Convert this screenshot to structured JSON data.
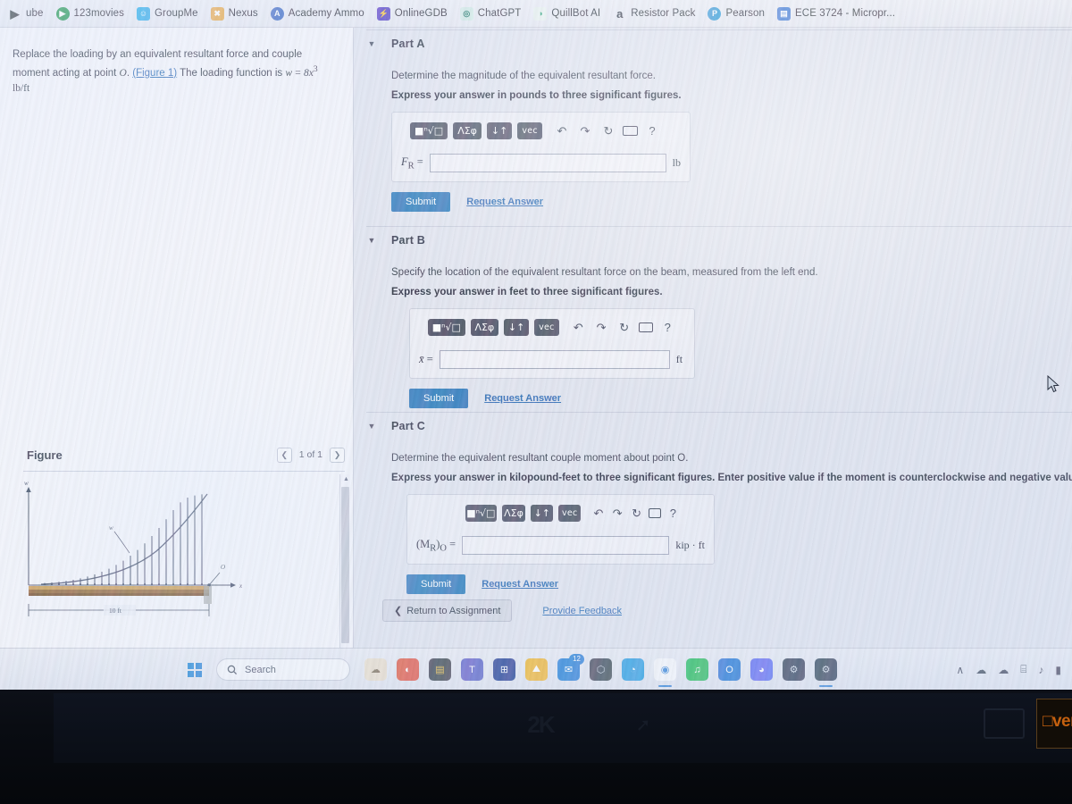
{
  "browser": {
    "bookmarks": [
      {
        "label": "ube",
        "icon": "youtube-icon",
        "icon_class": "ico-youtube",
        "glyph": "▶"
      },
      {
        "label": "123movies",
        "icon": "play-circle-icon",
        "icon_class": "ico-123movies",
        "glyph": "▶"
      },
      {
        "label": "GroupMe",
        "icon": "groupme-icon",
        "icon_class": "ico-groupme",
        "glyph": "☺"
      },
      {
        "label": "Nexus",
        "icon": "nexus-icon",
        "icon_class": "ico-nexus",
        "glyph": "✖"
      },
      {
        "label": "Academy Ammo",
        "icon": "academy-ammo-icon",
        "icon_class": "ico-academy",
        "glyph": "A"
      },
      {
        "label": "OnlineGDB",
        "icon": "onlinegdb-icon",
        "icon_class": "ico-onlinegdb",
        "glyph": "⚡"
      },
      {
        "label": "ChatGPT",
        "icon": "chatgpt-icon",
        "icon_class": "ico-chatgpt",
        "glyph": "◎"
      },
      {
        "label": "QuillBot AI",
        "icon": "quillbot-icon",
        "icon_class": "ico-quillbot",
        "glyph": "◑"
      },
      {
        "label": "Resistor Pack",
        "icon": "amazon-icon",
        "icon_class": "ico-amazon",
        "glyph": "a"
      },
      {
        "label": "Pearson",
        "icon": "pearson-icon",
        "icon_class": "ico-pearson",
        "glyph": "P"
      },
      {
        "label": "ECE 3724 - Micropr...",
        "icon": "canvas-icon",
        "icon_class": "ico-ece",
        "glyph": "▤"
      }
    ]
  },
  "problem": {
    "statement_part1": "Replace the loading by an equivalent resultant force and couple moment acting at point ",
    "point_label": "O",
    "statement_link": "(Figure 1)",
    "statement_part2": " The loading function is ",
    "loading_function": "w = 8x³ lb/ft",
    "loading_w": "w",
    "loading_eq": "=",
    "loading_rhs": "8x",
    "loading_exp": "3",
    "loading_units": "lb/ft"
  },
  "figure": {
    "title": "Figure",
    "pager": "1 of 1",
    "prev_icon": "chevron-left-icon",
    "next_icon": "chevron-right-icon",
    "dimension_label": "10 ft",
    "axis_w_label": "w",
    "axis_x_label": "x",
    "curve_label": "w",
    "point_label": "O"
  },
  "parts": [
    {
      "id": "part-a",
      "title": "Part A",
      "prompt": "Determine the magnitude of the equivalent resultant force.",
      "sub": "Express your answer in pounds to three significant figures.",
      "field_label": "F",
      "field_sub": "R",
      "field_eq": "=",
      "field_value": "",
      "unit": "lb",
      "submit_label": "Submit",
      "request_label": "Request Answer"
    },
    {
      "id": "part-b",
      "title": "Part B",
      "prompt": "Specify the location of the equivalent resultant force on the beam, measured from the left end.",
      "sub": "Express your answer in feet to three significant figures.",
      "field_label": "x̄",
      "field_sub": "",
      "field_eq": "=",
      "field_value": "",
      "unit": "ft",
      "submit_label": "Submit",
      "request_label": "Request Answer"
    },
    {
      "id": "part-c",
      "title": "Part C",
      "prompt": "Determine the equivalent resultant couple moment about point O.",
      "sub": "Express your answer in kilopound-feet to three significant figures. Enter positive value if the moment is counterclockwise and negative value if the moment is clockwise.",
      "field_label": "(M",
      "field_sub": "R",
      "field_close": ")",
      "field_sub2": "O",
      "field_eq": "=",
      "field_value": "",
      "unit": "kip · ft",
      "submit_label": "Submit",
      "request_label": "Request Answer"
    }
  ],
  "mathbar": {
    "buttons": [
      {
        "name": "template-root-button",
        "label": "■ⁿ√□"
      },
      {
        "name": "greek-symbols-button",
        "label": "ΛΣφ"
      },
      {
        "name": "more-templates-button",
        "label": "↓↑"
      },
      {
        "name": "vector-button",
        "label": "vec"
      }
    ],
    "tools": [
      {
        "name": "undo-icon",
        "label": "↶"
      },
      {
        "name": "redo-icon",
        "label": "↷"
      },
      {
        "name": "reset-icon",
        "label": "↻"
      },
      {
        "name": "keyboard-icon",
        "label": "⌨"
      },
      {
        "name": "help-icon",
        "label": "?"
      }
    ]
  },
  "footer": {
    "return_label": "Return to Assignment",
    "return_icon": "chevron-left-icon",
    "feedback_label": "Provide Feedback"
  },
  "taskbar": {
    "search_placeholder": "Search",
    "search_icon": "search-icon",
    "start_icon": "windows-start-icon",
    "apps": [
      {
        "name": "taskbar-icon-widgets",
        "glyph": "☁",
        "color": "#e8ddc9",
        "text": "#7a6a4f",
        "badge": "",
        "active": false
      },
      {
        "name": "taskbar-icon-paint",
        "glyph": "◐",
        "color": "#e0533f",
        "text": "#ffffff",
        "badge": "",
        "active": false
      },
      {
        "name": "taskbar-icon-file-explorer",
        "glyph": "▤",
        "color": "#3a3f4b",
        "text": "#f2c24a",
        "badge": "",
        "active": false
      },
      {
        "name": "taskbar-icon-teams",
        "glyph": "T",
        "color": "#5b5fc7",
        "text": "#ffffff",
        "badge": "",
        "active": false
      },
      {
        "name": "taskbar-icon-store",
        "glyph": "⊞",
        "color": "#1a3a8f",
        "text": "#ffffff",
        "badge": "",
        "active": false
      },
      {
        "name": "taskbar-icon-photos",
        "glyph": "⛰",
        "color": "#f0b429",
        "text": "#ffffff",
        "badge": "",
        "active": false
      },
      {
        "name": "taskbar-icon-mail",
        "glyph": "✉",
        "color": "#1f7ad6",
        "text": "#ffffff",
        "badge": "12",
        "active": false
      },
      {
        "name": "taskbar-icon-copilot",
        "glyph": "⬡",
        "color": "#39424f",
        "text": "#c7d0dd",
        "badge": "",
        "active": false
      },
      {
        "name": "taskbar-icon-edge",
        "glyph": "◔",
        "color": "#1f9ae0",
        "text": "#ffffff",
        "badge": "",
        "active": false
      },
      {
        "name": "taskbar-icon-chrome",
        "glyph": "◉",
        "color": "#f7f8fb",
        "text": "#2b7fd6",
        "badge": "",
        "active": true
      },
      {
        "name": "taskbar-icon-spotify",
        "glyph": "♫",
        "color": "#1db954",
        "text": "#ffffff",
        "badge": "",
        "active": false
      },
      {
        "name": "taskbar-icon-outlook",
        "glyph": "O",
        "color": "#1b6fd4",
        "text": "#ffffff",
        "badge": "",
        "active": false
      },
      {
        "name": "taskbar-icon-discord",
        "glyph": "◕",
        "color": "#5865f2",
        "text": "#ffffff",
        "badge": "",
        "active": false
      },
      {
        "name": "taskbar-icon-steam",
        "glyph": "⚙",
        "color": "#2a3a50",
        "text": "#cfd8e4",
        "badge": "",
        "active": false
      },
      {
        "name": "taskbar-icon-steam-2",
        "glyph": "⚙",
        "color": "#2a3a50",
        "text": "#cfd8e4",
        "badge": "",
        "active": true
      }
    ],
    "tray": [
      {
        "name": "show-hidden-icons-icon",
        "glyph": "∧"
      },
      {
        "name": "onedrive-icon",
        "glyph": "☁"
      },
      {
        "name": "cloud-sync-icon",
        "glyph": "☁"
      },
      {
        "name": "network-icon",
        "glyph": "⌸"
      },
      {
        "name": "volume-icon",
        "glyph": "♪"
      },
      {
        "name": "battery-icon",
        "glyph": "▮"
      }
    ]
  },
  "laptop": {
    "sticker_2k": "2K",
    "sticker_overclock": "□verc",
    "bezel_text": ""
  },
  "colors": {
    "accent_blue": "#1b6fb5",
    "link_blue": "#1b5fae",
    "mathbtn_dark": "#3f4457",
    "beam_brown": "#8a5a22"
  }
}
